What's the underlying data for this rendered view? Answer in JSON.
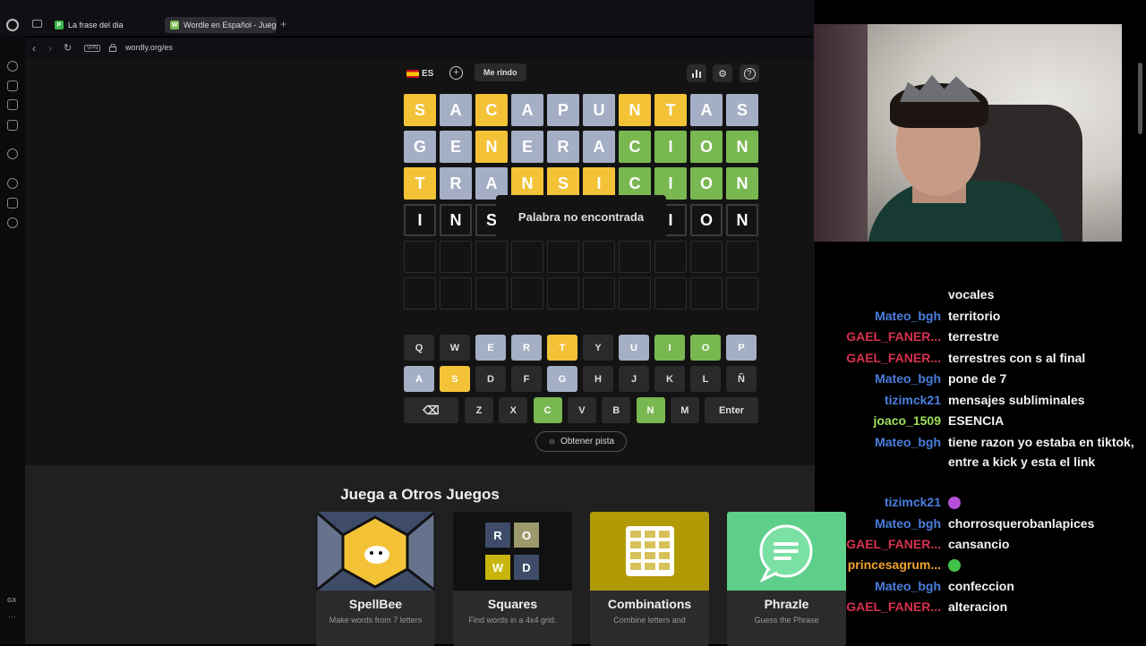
{
  "browser": {
    "tabs": [
      {
        "label": "La frase del dia",
        "icon": "P",
        "icon_color": "#3bb54a"
      },
      {
        "label": "Wordle en Español - Juego",
        "icon": "W",
        "icon_color": "#79b851"
      }
    ],
    "url": "wordly.org/es",
    "vpn_label": "VPN",
    "gx_label": "GX"
  },
  "topbar": {
    "lang": "ES",
    "give_up": "Me rindo"
  },
  "board": [
    [
      [
        "S",
        "y"
      ],
      [
        "A",
        "a"
      ],
      [
        "C",
        "y"
      ],
      [
        "A",
        "a"
      ],
      [
        "P",
        "a"
      ],
      [
        "U",
        "a"
      ],
      [
        "N",
        "y"
      ],
      [
        "T",
        "y"
      ],
      [
        "A",
        "a"
      ],
      [
        "S",
        "a"
      ]
    ],
    [
      [
        "G",
        "a"
      ],
      [
        "E",
        "a"
      ],
      [
        "N",
        "y"
      ],
      [
        "E",
        "a"
      ],
      [
        "R",
        "a"
      ],
      [
        "A",
        "a"
      ],
      [
        "C",
        "g"
      ],
      [
        "I",
        "g"
      ],
      [
        "O",
        "g"
      ],
      [
        "N",
        "g"
      ]
    ],
    [
      [
        "T",
        "y"
      ],
      [
        "R",
        "a"
      ],
      [
        "A",
        "a"
      ],
      [
        "N",
        "y"
      ],
      [
        "S",
        "y"
      ],
      [
        "I",
        "y"
      ],
      [
        "C",
        "g"
      ],
      [
        "I",
        "g"
      ],
      [
        "O",
        "g"
      ],
      [
        "N",
        "g"
      ]
    ],
    [
      [
        "I",
        "f"
      ],
      [
        "N",
        "f"
      ],
      [
        "S",
        "f"
      ],
      [
        "",
        ""
      ],
      [
        "",
        ""
      ],
      [
        "",
        ""
      ],
      [
        "",
        ""
      ],
      [
        "I",
        "f"
      ],
      [
        "O",
        "f"
      ],
      [
        "N",
        "f"
      ]
    ],
    [
      [
        "",
        "e"
      ],
      [
        "",
        "e"
      ],
      [
        "",
        "e"
      ],
      [
        "",
        "e"
      ],
      [
        "",
        "e"
      ],
      [
        "",
        "e"
      ],
      [
        "",
        "e"
      ],
      [
        "",
        "e"
      ],
      [
        "",
        "e"
      ],
      [
        "",
        "e"
      ]
    ],
    [
      [
        "",
        "e"
      ],
      [
        "",
        "e"
      ],
      [
        "",
        "e"
      ],
      [
        "",
        "e"
      ],
      [
        "",
        "e"
      ],
      [
        "",
        "e"
      ],
      [
        "",
        "e"
      ],
      [
        "",
        "e"
      ],
      [
        "",
        "e"
      ],
      [
        "",
        "e"
      ]
    ]
  ],
  "toast": "Palabra no encontrada",
  "keyboard": {
    "row1": [
      [
        "Q",
        ""
      ],
      [
        "W",
        ""
      ],
      [
        "E",
        "a"
      ],
      [
        "R",
        "a"
      ],
      [
        "T",
        "y"
      ],
      [
        "Y",
        ""
      ],
      [
        "U",
        "a"
      ],
      [
        "I",
        "g"
      ],
      [
        "O",
        "g"
      ],
      [
        "P",
        "a"
      ]
    ],
    "row2": [
      [
        "A",
        "a"
      ],
      [
        "S",
        "y"
      ],
      [
        "D",
        ""
      ],
      [
        "F",
        ""
      ],
      [
        "G",
        "a"
      ],
      [
        "H",
        ""
      ],
      [
        "J",
        ""
      ],
      [
        "K",
        ""
      ],
      [
        "L",
        ""
      ],
      [
        "Ñ",
        ""
      ]
    ],
    "row3": [
      [
        "Z",
        ""
      ],
      [
        "X",
        ""
      ],
      [
        "C",
        "g"
      ],
      [
        "V",
        ""
      ],
      [
        "B",
        ""
      ],
      [
        "N",
        "g"
      ],
      [
        "M",
        ""
      ]
    ],
    "enter": "Enter"
  },
  "hint": "Obtener pista",
  "games": {
    "title": "Juega a Otros Juegos",
    "items": [
      {
        "name": "SpellBee",
        "desc": "Make words from 7 letters",
        "color": "#3e4c6a"
      },
      {
        "name": "Squares",
        "desc": "Find words in a 4x4 grid.",
        "color": "#111111",
        "letters": [
          "R",
          "O",
          "W",
          "D"
        ]
      },
      {
        "name": "Combinations",
        "desc": "Combine letters and",
        "color": "#b09a05"
      },
      {
        "name": "Phrazle",
        "desc": "Guess the Phrase",
        "color": "#5dcf8a"
      }
    ]
  },
  "chat": [
    {
      "user": "",
      "color": "#5b8def",
      "text": "vocales"
    },
    {
      "user": "Mateo_bgh",
      "color": "#4a7fe0",
      "text": "territorio"
    },
    {
      "user": "GAEL_FANER...",
      "color": "#d7304e",
      "text": "terrestre"
    },
    {
      "user": "GAEL_FANER...",
      "color": "#d7304e",
      "text": "terrestres con s al final"
    },
    {
      "user": "Mateo_bgh",
      "color": "#4a7fe0",
      "text": "pone de 7"
    },
    {
      "user": "tizimck21",
      "color": "#4a7fe0",
      "text": "mensajes subliminales"
    },
    {
      "user": "joaco_1509",
      "color": "#9ee05a",
      "text": "ESENCIA"
    },
    {
      "user": "Mateo_bgh",
      "color": "#4a7fe0",
      "text": "tiene razon yo estaba en tiktok, entre a kick y esta el link"
    },
    {
      "user": "tizimck21",
      "color": "#4a7fe0",
      "text": "",
      "emote_color": "#b34fd6"
    },
    {
      "user": "Mateo_bgh",
      "color": "#4a7fe0",
      "text": "chorrosquerobanlapices"
    },
    {
      "user": "GAEL_FANER...",
      "color": "#d7304e",
      "text": "cansancio"
    },
    {
      "user": "princesagrum...",
      "color": "#f0a330",
      "text": "",
      "emote_color": "#43c24a"
    },
    {
      "user": "Mateo_bgh",
      "color": "#4a7fe0",
      "text": "confeccion"
    },
    {
      "user": "GAEL_FANER...",
      "color": "#d7304e",
      "text": "alteracion"
    }
  ]
}
